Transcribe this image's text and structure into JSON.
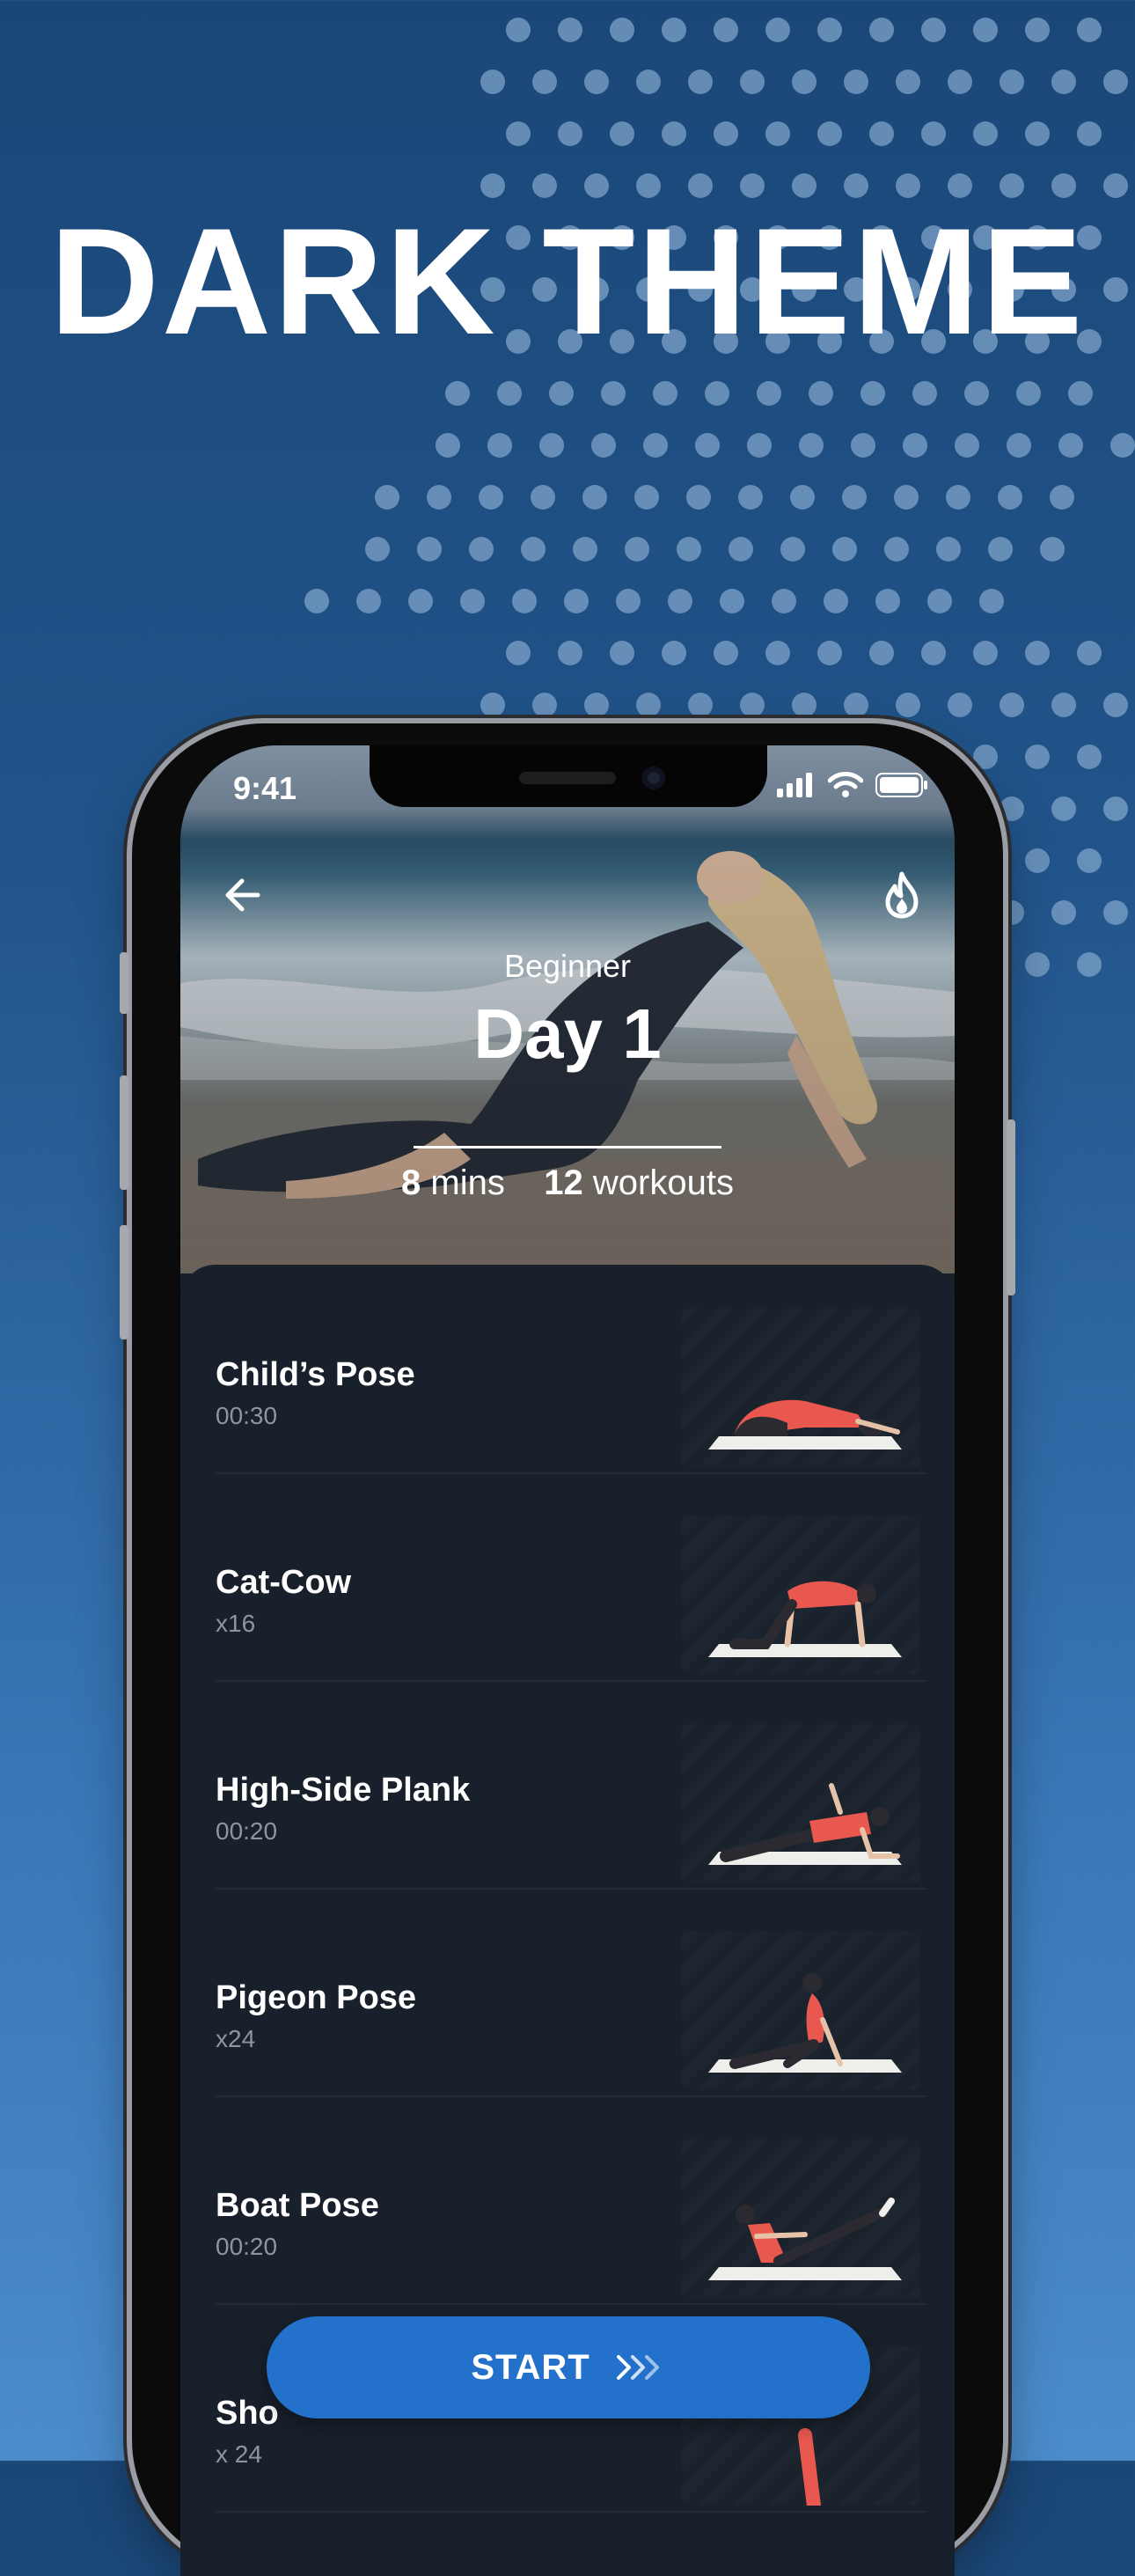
{
  "promo": {
    "headline": "DARK THEME"
  },
  "status_bar": {
    "time": "9:41"
  },
  "header": {
    "level": "Beginner",
    "title": "Day 1",
    "duration_value": "8",
    "duration_unit": "mins",
    "workouts_value": "12",
    "workouts_unit": "workouts"
  },
  "exercises": [
    {
      "name": "Child’s Pose",
      "detail": "00:30"
    },
    {
      "name": "Cat-Cow",
      "detail": "x16"
    },
    {
      "name": "High-Side Plank",
      "detail": "00:20"
    },
    {
      "name": "Pigeon Pose",
      "detail": "x24"
    },
    {
      "name": "Boat Pose",
      "detail": "00:20"
    },
    {
      "name": "Sho",
      "detail": "x 24"
    }
  ],
  "start_button": {
    "label": "START"
  },
  "colors": {
    "accent": "#2371cb",
    "panel": "#18202b",
    "pose_shirt": "#e8584f"
  }
}
